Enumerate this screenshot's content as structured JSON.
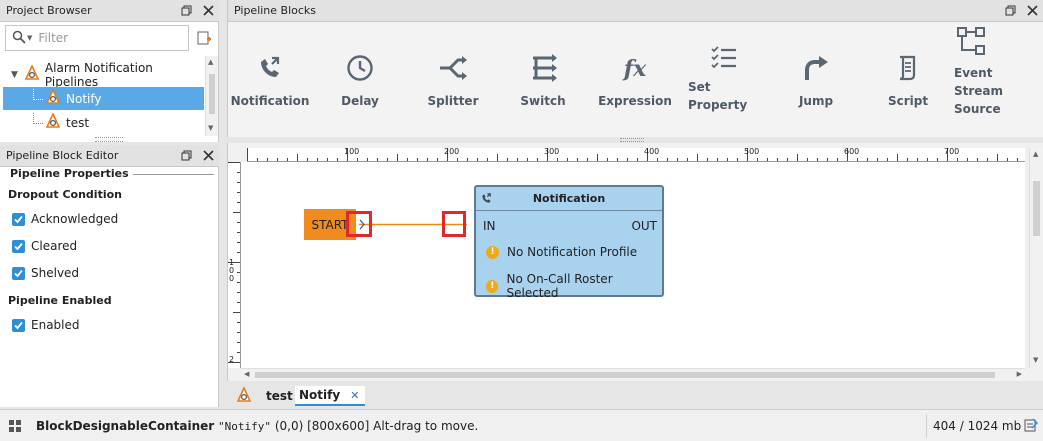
{
  "project_browser": {
    "title": "Project Browser",
    "filter_placeholder": "Filter",
    "tree": [
      {
        "label": "Alarm Notification Pipelines"
      },
      {
        "label": "Notify"
      },
      {
        "label": "test"
      }
    ]
  },
  "block_editor": {
    "title": "Pipeline Block Editor",
    "properties_title": "Pipeline Properties",
    "dropout_title": "Dropout Condition",
    "dropout_options": [
      {
        "label": "Acknowledged",
        "checked": true
      },
      {
        "label": "Cleared",
        "checked": true
      },
      {
        "label": "Shelved",
        "checked": true
      }
    ],
    "enabled_title": "Pipeline Enabled",
    "enabled_option": {
      "label": "Enabled",
      "checked": true
    }
  },
  "blocks_panel": {
    "title": "Pipeline Blocks",
    "tools": [
      {
        "label": "Notification",
        "icon": "phone-icon"
      },
      {
        "label": "Delay",
        "icon": "clock-icon"
      },
      {
        "label": "Splitter",
        "icon": "splitter-icon"
      },
      {
        "label": "Switch",
        "icon": "switch-icon"
      },
      {
        "label": "Expression",
        "icon": "fx-icon"
      },
      {
        "label": "Set Property",
        "icon": "checklist-icon"
      },
      {
        "label": "Jump",
        "icon": "jump-arrow-icon"
      },
      {
        "label": "Script",
        "icon": "script-icon"
      },
      {
        "label": "Event Stream Source",
        "icon": "network-icon"
      }
    ],
    "fx_glyph": "fx"
  },
  "canvas": {
    "ruler_h_labels": [
      "100",
      "200",
      "300",
      "400",
      "500",
      "600",
      "700"
    ],
    "ruler_v_labels": [
      "1",
      "0",
      "0",
      "2"
    ],
    "start_label": "START",
    "notification_block": {
      "title": "Notification",
      "in_label": "IN",
      "out_label": "OUT",
      "warnings": [
        "No Notification Profile",
        "No On-Call Roster Selected"
      ],
      "warning_glyph": "!"
    }
  },
  "tabs": [
    {
      "label": "test",
      "active": false
    },
    {
      "label": "Notify",
      "active": true
    }
  ],
  "tab_close_glyph": "✕",
  "status_bar": {
    "component": "BlockDesignableContainer",
    "component_name": "\"Notify\"",
    "details": "(0,0) [800x600] Alt-drag to move.",
    "memory": "404 / 1024 mb"
  },
  "colors": {
    "selection": "#5aa9e6",
    "start_block": "#f08c1f",
    "notification_block": "#a9d2ef",
    "highlight": "#e02828",
    "checkbox": "#2f8fd6"
  }
}
